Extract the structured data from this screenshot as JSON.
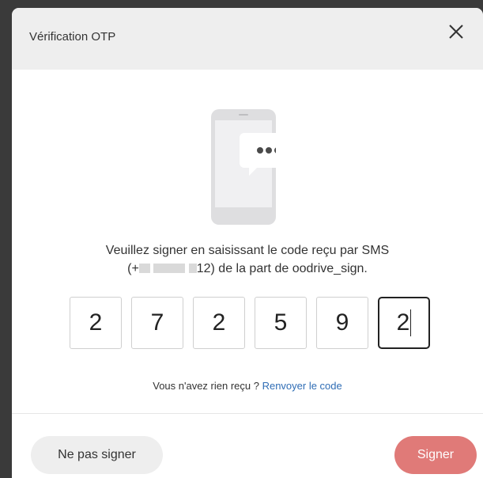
{
  "header": {
    "title": "Vérification OTP",
    "close_icon": "close-icon"
  },
  "illustration": {
    "icon": "phone-sms-icon"
  },
  "message": {
    "line1": "Veuillez signer en saisissant le code reçu par SMS",
    "phone_prefix": "(+",
    "phone_suffix": "12)",
    "line2_rest": " de la part de oodrive_sign."
  },
  "otp": {
    "digits": [
      "2",
      "7",
      "2",
      "5",
      "9",
      "2"
    ]
  },
  "resend": {
    "prompt": "Vous n'avez rien reçu ? ",
    "link": "Renvoyer le code"
  },
  "footer": {
    "decline_label": "Ne pas signer",
    "sign_label": "Signer"
  },
  "colors": {
    "sign_button": "#e07a78",
    "link": "#2f6db5",
    "header_bg": "#eeeeee"
  }
}
